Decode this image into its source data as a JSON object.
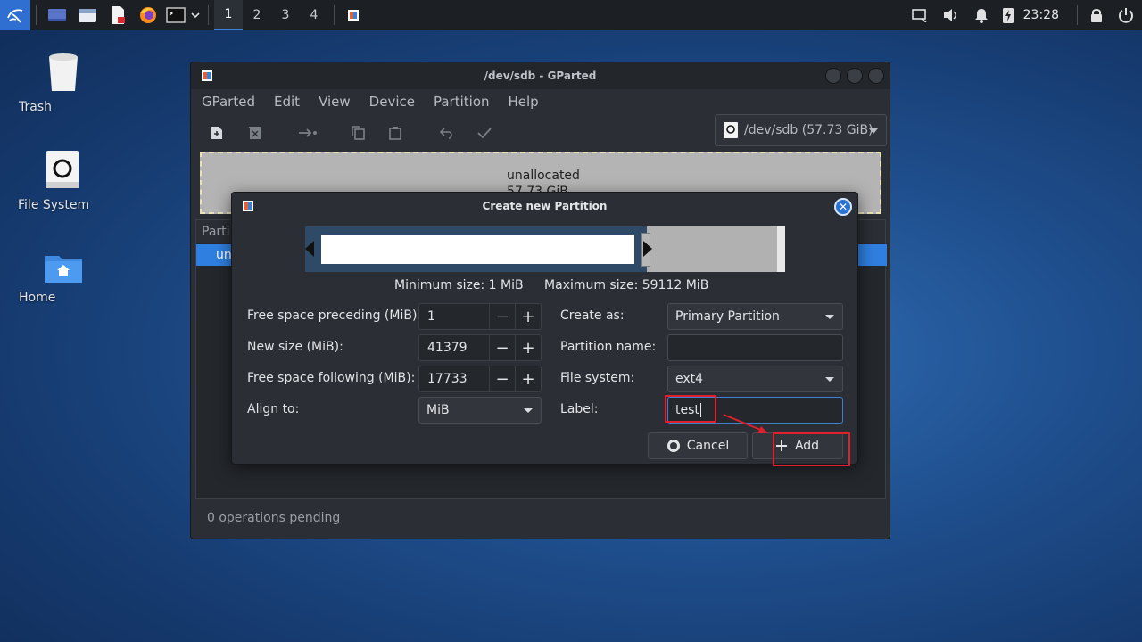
{
  "taskbar": {
    "workspaces": [
      "1",
      "2",
      "3",
      "4"
    ],
    "active_workspace": "1",
    "clock": "23:28",
    "icons": [
      "kali-menu-icon",
      "desktop-icon",
      "file-manager-icon",
      "text-editor-icon",
      "firefox-icon",
      "terminal-icon",
      "chevron-down-icon",
      "gparted-task-icon"
    ]
  },
  "desktop": {
    "trash_label": "Trash",
    "filesystem_label": "File System",
    "home_label": "Home"
  },
  "gparted": {
    "title": "/dev/sdb - GParted",
    "menu": [
      "GParted",
      "Edit",
      "View",
      "Device",
      "Partition",
      "Help"
    ],
    "device_selector": "/dev/sdb (57.73 GiB)",
    "partmap_line1": "unallocated",
    "partmap_line2": "57.73 GiB",
    "list_header": "Parti",
    "list_row": "una",
    "status": "0 operations pending"
  },
  "dialog": {
    "title": "Create new Partition",
    "min_size": "Minimum size: 1 MiB",
    "max_size": "Maximum size: 59112 MiB",
    "free_before_label": "Free space preceding (MiB):",
    "free_before_value": "1",
    "new_size_label": "New size (MiB):",
    "new_size_value": "41379",
    "free_after_label": "Free space following (MiB):",
    "free_after_value": "17733",
    "align_label": "Align to:",
    "align_value": "MiB",
    "create_as_label": "Create as:",
    "create_as_value": "Primary Partition",
    "part_name_label": "Partition name:",
    "part_name_value": "",
    "fs_label": "File system:",
    "fs_value": "ext4",
    "label_label": "Label:",
    "label_value": "test",
    "cancel": "Cancel",
    "add": "Add",
    "minus": "−",
    "plus": "+"
  },
  "colors": {
    "accent": "#3b82d6",
    "annotation": "#e0202a"
  }
}
